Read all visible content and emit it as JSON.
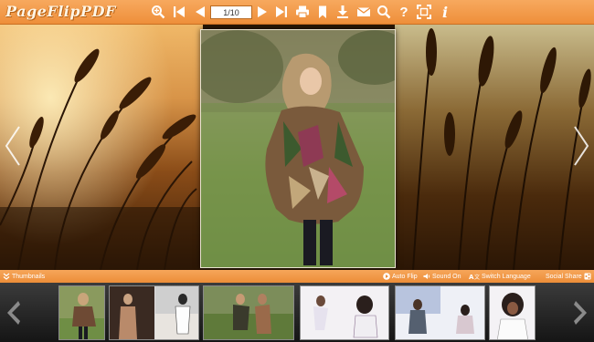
{
  "toolbar": {
    "logo": "PageFlipPDF",
    "page_indicator": "1/10",
    "buttons": [
      "zoom-in-icon",
      "first-page-icon",
      "previous-page-icon",
      "next-page-icon",
      "last-page-icon",
      "print-icon",
      "bookmark-icon",
      "download-icon",
      "email-icon",
      "search-icon",
      "help-icon",
      "fullscreen-icon",
      "info-icon"
    ],
    "help_glyph": "?",
    "info_glyph": "i"
  },
  "page": {
    "caption": ""
  },
  "controls": {
    "thumbnails": "Thumbnails",
    "auto_flip": "Auto Flip",
    "sound_on": "Sound On",
    "switch_language": "Switch Language",
    "social_share": "Social Share"
  },
  "thumbnails": {
    "count": 8,
    "current": 1
  },
  "colors": {
    "accent": "#f29a48",
    "toolbar_dark": "#c96f22",
    "strip": "#222222"
  }
}
